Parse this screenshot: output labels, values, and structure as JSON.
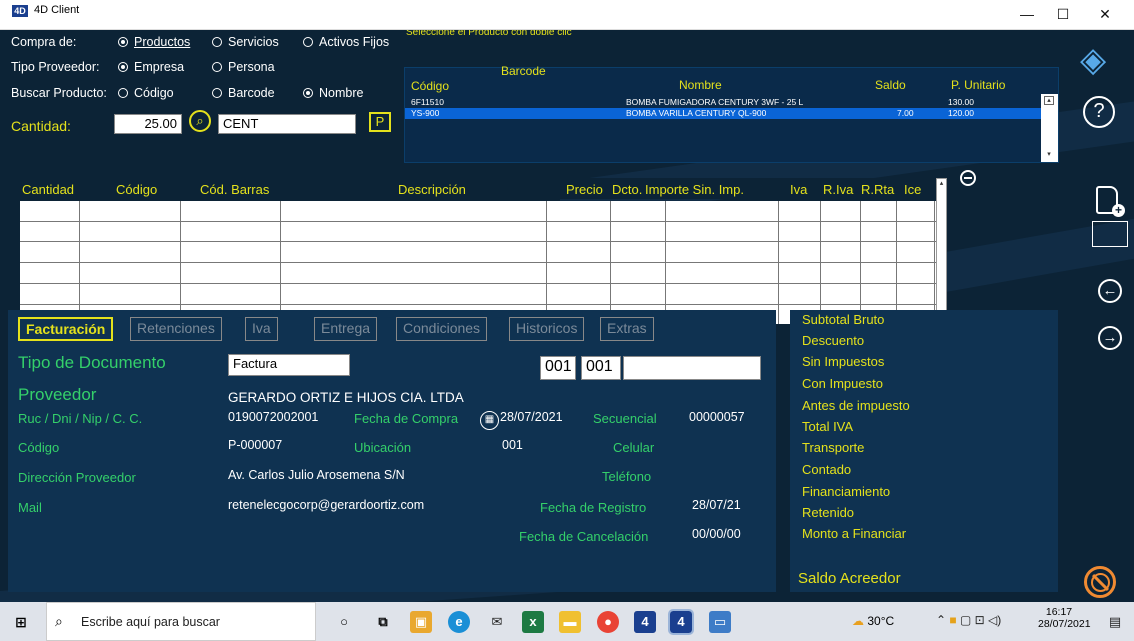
{
  "window": {
    "title": "4D Client",
    "minimize": "—",
    "maximize": "☐",
    "close": "✕"
  },
  "header": {
    "compra_label": "Compra de:",
    "compra_options": [
      "Productos",
      "Servicios",
      "Activos Fijos"
    ],
    "proveedor_label": "Tipo Proveedor:",
    "proveedor_options": [
      "Empresa",
      "Persona"
    ],
    "buscar_label": "Buscar Producto:",
    "buscar_options": [
      "Código",
      "Barcode",
      "Nombre"
    ],
    "cantidad_label": "Cantidad:",
    "cantidad_value": "25.00",
    "search_value": "CENT",
    "p_button": "P"
  },
  "product_list": {
    "hint": "Seleccione el Producto con doble clic",
    "headers": [
      "Código",
      "Barcode",
      "Nombre",
      "Saldo",
      "P. Unitario"
    ],
    "rows": [
      {
        "codigo": "6F11510",
        "barcode": "",
        "nombre": "BOMBA FUMIGADORA CENTURY 3WF - 25 L",
        "saldo": "",
        "precio": "130.00"
      },
      {
        "codigo": "YS-900",
        "barcode": "",
        "nombre": "BOMBA VARILLA CENTURY QL-900",
        "saldo": "7.00",
        "precio": "120.00"
      }
    ]
  },
  "grid": {
    "headers": [
      "Cantidad",
      "Código",
      "Cód. Barras",
      "Descripción",
      "Precio",
      "Dcto.",
      "Importe Sin. Imp.",
      "Iva",
      "R.Iva",
      "R.Rta",
      "Ice"
    ]
  },
  "tabs": [
    "Facturación",
    "Retenciones",
    "Iva",
    "Entrega",
    "Condiciones",
    "Historicos",
    "Extras"
  ],
  "form": {
    "tipo_doc_label": "Tipo de Documento",
    "tipo_doc_value": "Factura",
    "serie1": "001",
    "serie2": "001",
    "serie3": "",
    "proveedor_label": "Proveedor",
    "proveedor_value": "GERARDO ORTIZ E HIJOS CIA. LTDA",
    "ruc_label": "Ruc / Dni / Nip / C. C.",
    "ruc_value": "0190072002001",
    "fecha_compra_label": "Fecha de Compra",
    "fecha_compra_value": "28/07/2021",
    "secuencial_label": "Secuencial",
    "secuencial_value": "00000057",
    "codigo_label": "Código",
    "codigo_value": "P-000007",
    "ubicacion_label": "Ubicación",
    "ubicacion_value": "001",
    "celular_label": "Celular",
    "direccion_label": "Dirección Proveedor",
    "direccion_value": "Av. Carlos Julio Arosemena S/N",
    "telefono_label": "Teléfono",
    "mail_label": "Mail",
    "mail_value": "retenelecgocorp@gerardoortiz.com",
    "fecha_registro_label": "Fecha de Registro",
    "fecha_registro_value": "28/07/21",
    "fecha_cancel_label": "Fecha de Cancelación",
    "fecha_cancel_value": "00/00/00"
  },
  "totals": [
    "Subtotal Bruto",
    "Descuento",
    "Sin Impuestos",
    "Con Impuesto",
    "Antes de impuesto",
    "Total IVA",
    "Transporte",
    "Contado",
    "Financiamiento",
    "Retenido",
    "Monto a Financiar"
  ],
  "saldo_label": "Saldo Acreedor",
  "taskbar": {
    "search_placeholder": "Escribe aquí para buscar",
    "weather": "30°C",
    "time": "16:17",
    "date": "28/07/2021"
  }
}
